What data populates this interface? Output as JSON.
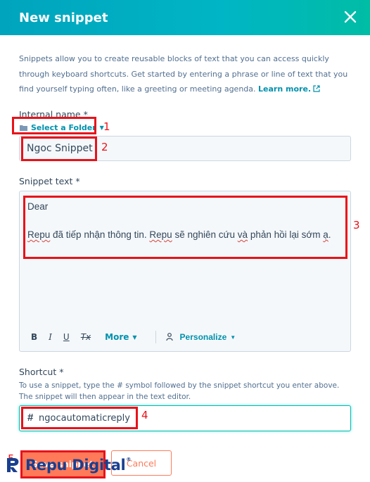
{
  "header": {
    "title": "New snippet"
  },
  "intro": {
    "text": "Snippets allow you to create reusable blocks of text that you can access quickly through keyboard shortcuts. Get started by entering a phrase or line of text that you find yourself typing often, like a greeting or meeting agenda.",
    "link": "Learn more."
  },
  "internal_name": {
    "label": "Internal name *",
    "folder_button": "Select a Folder",
    "value": "Ngoc Snippet"
  },
  "snippet": {
    "label": "Snippet text *",
    "line1": "Dear",
    "line2_parts": [
      "Repu",
      " đã tiếp nhận thông tin. ",
      "Repu",
      " sẽ nghiên cứu ",
      "và",
      " phản hồi lại sớm ",
      "ạ",
      "."
    ],
    "toolbar": {
      "bold": "B",
      "italic": "I",
      "underline": "U",
      "clear": "Tx",
      "more": "More",
      "personalize": "Personalize"
    }
  },
  "shortcut": {
    "label": "Shortcut *",
    "help": "To use a snippet, type the # symbol followed by the snippet shortcut you enter above. The snippet will then appear in the text editor.",
    "hash": "#",
    "value": "ngocautomaticreply"
  },
  "actions": {
    "save": "Save snippet",
    "cancel": "Cancel"
  },
  "annotations": [
    "1",
    "2",
    "3",
    "4",
    "5"
  ],
  "watermark": {
    "text": "Repu Digital",
    "reg": "®"
  },
  "colors": {
    "header_start": "#00a4bd",
    "header_end": "#00bda5",
    "link": "#0091ae",
    "primary": "#ff7a59",
    "annotation": "#e8121a"
  }
}
